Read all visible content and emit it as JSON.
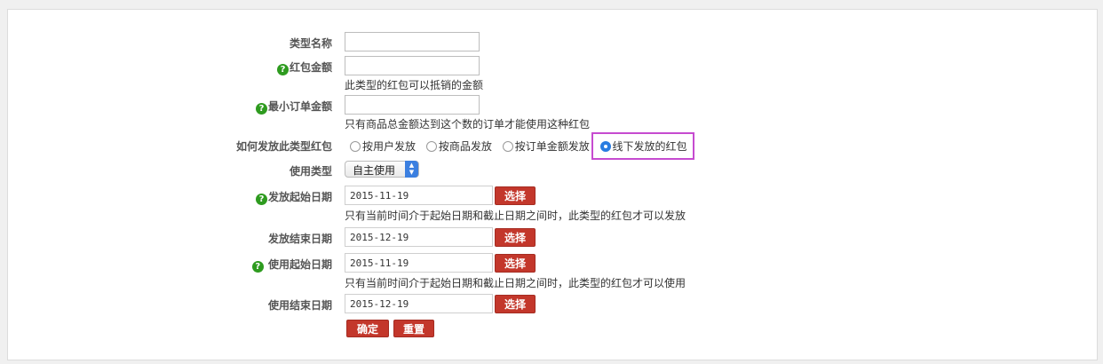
{
  "form": {
    "type_name": {
      "label": "类型名称",
      "value": ""
    },
    "amount": {
      "label": "红包金额",
      "value": "",
      "note": "此类型的红包可以抵销的金额",
      "help": "?"
    },
    "min_order": {
      "label": "最小订单金额",
      "value": "",
      "note": "只有商品总金额达到这个数的订单才能使用这种红包",
      "help": "?"
    },
    "send_type": {
      "label": "如何发放此类型红包",
      "options": [
        "按用户发放",
        "按商品发放",
        "按订单金额发放",
        "线下发放的红包"
      ],
      "selected_index": 3
    },
    "use_type": {
      "label": "使用类型",
      "value": "自主使用"
    },
    "send_start": {
      "label": "发放起始日期",
      "value": "2015-11-19",
      "note": "只有当前时间介于起始日期和截止日期之间时，此类型的红包才可以发放",
      "help": "?"
    },
    "send_end": {
      "label": "发放结束日期",
      "value": "2015-12-19"
    },
    "use_start": {
      "label": "使用起始日期",
      "value": "2015-11-19",
      "note": "只有当前时间介于起始日期和截止日期之间时，此类型的红包才可以使用",
      "help": "?"
    },
    "use_end": {
      "label": "使用结束日期",
      "value": "2015-12-19"
    },
    "choose_label": "选择",
    "confirm_label": "确定",
    "reset_label": "重置"
  },
  "colors": {
    "accent_button": "#c3372b",
    "help_icon": "#2e9b1f",
    "highlight": "#c64bd0",
    "radio_on": "#2a7de1"
  }
}
